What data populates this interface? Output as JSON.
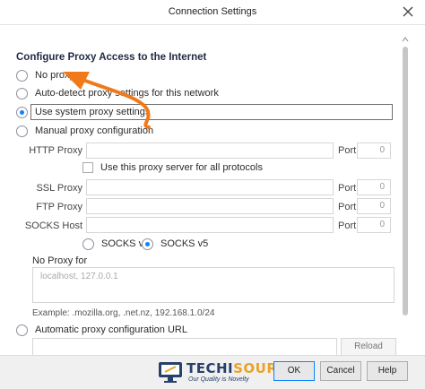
{
  "window": {
    "title": "Connection Settings"
  },
  "heading": "Configure Proxy Access to the Internet",
  "proxy_options": [
    {
      "label": "No proxy",
      "checked": false
    },
    {
      "label": "Auto-detect proxy settings for this network",
      "checked": false
    },
    {
      "label": "Use system proxy settings",
      "checked": true
    },
    {
      "label": "Manual proxy configuration",
      "checked": false
    }
  ],
  "manual": {
    "http_label": "HTTP Proxy",
    "port_label": "Port",
    "http_port": "0",
    "use_for_all": "Use this proxy server for all protocols",
    "ssl_label": "SSL Proxy",
    "ssl_port": "0",
    "ftp_label": "FTP Proxy",
    "ftp_port": "0",
    "socks_label": "SOCKS Host",
    "socks_port": "0",
    "socks_v4": "SOCKS v4",
    "socks_v5": "SOCKS v5",
    "socks_v5_checked": true
  },
  "no_proxy": {
    "label": "No Proxy for",
    "value": "localhost, 127.0.0.1",
    "example": "Example: .mozilla.org, .net.nz, 192.168.1.0/24"
  },
  "auto_url": {
    "label": "Automatic proxy configuration URL",
    "reload": "Reload"
  },
  "footer": {
    "ok": "OK",
    "cancel": "Cancel",
    "help": "Help"
  },
  "watermark": {
    "brand_part1": "TECHI",
    "brand_part2": "SOURS",
    "tagline": "Our Quality is Novelty"
  },
  "colors": {
    "accent": "#0a84ff",
    "annotation_arrow": "#f07a1a"
  }
}
